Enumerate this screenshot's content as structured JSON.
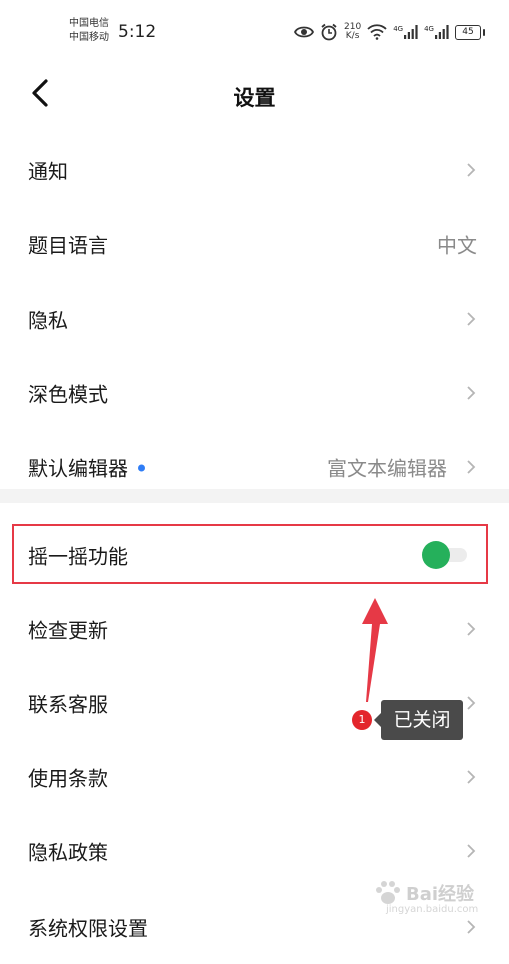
{
  "status_bar": {
    "carrier_1": "中国电信",
    "carrier_2": "中国移动",
    "time": "5:12",
    "net_speed_value": "210",
    "net_speed_unit": "K/s",
    "signal_1": "4G",
    "signal_2": "4G",
    "battery": "45"
  },
  "header": {
    "title": "设置"
  },
  "settings": {
    "notifications": {
      "label": "通知"
    },
    "question_language": {
      "label": "题目语言",
      "value": "中文"
    },
    "privacy": {
      "label": "隐私"
    },
    "dark_mode": {
      "label": "深色模式"
    },
    "default_editor": {
      "label": "默认编辑器",
      "value": "富文本编辑器"
    },
    "shake": {
      "label": "摇一摇功能",
      "enabled": true
    },
    "check_update": {
      "label": "检查更新"
    },
    "customer_service": {
      "label": "联系客服"
    },
    "terms": {
      "label": "使用条款"
    },
    "privacy_policy": {
      "label": "隐私政策"
    },
    "system_permissions": {
      "label": "系统权限设置"
    }
  },
  "annotation": {
    "step_number": "1",
    "tooltip": "已关闭",
    "color": "#e63946"
  },
  "watermark": {
    "brand": "Bai经验",
    "url": "jingyan.baidu.com"
  },
  "colors": {
    "toggle_on": "#25b05b",
    "dot_blue": "#2f7df6",
    "chevron": "#b5b5b5"
  }
}
